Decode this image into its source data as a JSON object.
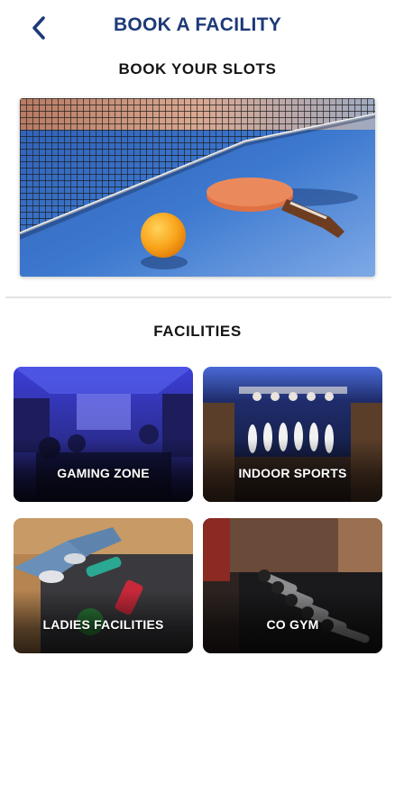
{
  "header": {
    "title": "BOOK A FACILITY",
    "back_icon": "chevron-left-icon"
  },
  "slots": {
    "title": "BOOK YOUR SLOTS",
    "hero_image": "table-tennis-image"
  },
  "facilities": {
    "title": "FACILITIES",
    "items": [
      {
        "label": "GAMING ZONE",
        "image": "gaming-zone-image"
      },
      {
        "label": "INDOOR SPORTS",
        "image": "bowling-alley-image"
      },
      {
        "label": "LADIES FACILITIES",
        "image": "ladies-fitness-image"
      },
      {
        "label": "CO GYM",
        "image": "dumbbell-rack-image"
      }
    ]
  },
  "colors": {
    "title_blue": "#1d3a78",
    "text_dark": "#151515",
    "divider": "#e3e3e3"
  }
}
